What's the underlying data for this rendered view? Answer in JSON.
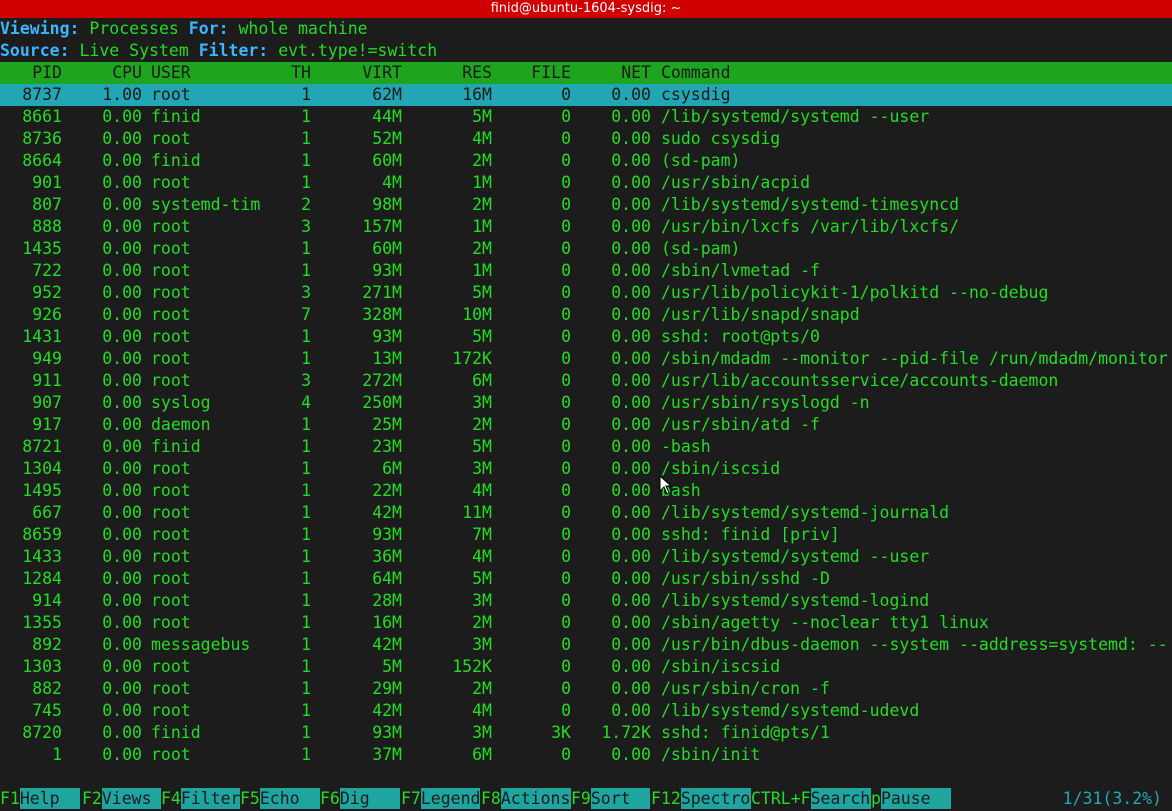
{
  "window": {
    "title": "finid@ubuntu-1604-sysdig: ~"
  },
  "header": {
    "viewing_key": "Viewing:",
    "viewing_value": "Processes",
    "for_key": "For:",
    "for_value": "whole machine",
    "source_key": "Source:",
    "source_value": "Live System",
    "filter_key": "Filter:",
    "filter_value": "evt.type!=switch"
  },
  "columns": {
    "pid": "PID",
    "cpu": "CPU",
    "user": "USER",
    "th": "TH",
    "virt": "VIRT",
    "res": "RES",
    "file": "FILE",
    "net": "NET",
    "command": "Command"
  },
  "processes": [
    {
      "pid": "8737",
      "cpu": "1.00",
      "user": "root",
      "th": "1",
      "virt": "62M",
      "res": "16M",
      "file": "0",
      "net": "0.00",
      "command": "csysdig"
    },
    {
      "pid": "8661",
      "cpu": "0.00",
      "user": "finid",
      "th": "1",
      "virt": "44M",
      "res": "5M",
      "file": "0",
      "net": "0.00",
      "command": "/lib/systemd/systemd --user"
    },
    {
      "pid": "8736",
      "cpu": "0.00",
      "user": "root",
      "th": "1",
      "virt": "52M",
      "res": "4M",
      "file": "0",
      "net": "0.00",
      "command": "sudo csysdig"
    },
    {
      "pid": "8664",
      "cpu": "0.00",
      "user": "finid",
      "th": "1",
      "virt": "60M",
      "res": "2M",
      "file": "0",
      "net": "0.00",
      "command": "(sd-pam)"
    },
    {
      "pid": "901",
      "cpu": "0.00",
      "user": "root",
      "th": "1",
      "virt": "4M",
      "res": "1M",
      "file": "0",
      "net": "0.00",
      "command": "/usr/sbin/acpid"
    },
    {
      "pid": "807",
      "cpu": "0.00",
      "user": "systemd-tim",
      "th": "2",
      "virt": "98M",
      "res": "2M",
      "file": "0",
      "net": "0.00",
      "command": "/lib/systemd/systemd-timesyncd"
    },
    {
      "pid": "888",
      "cpu": "0.00",
      "user": "root",
      "th": "3",
      "virt": "157M",
      "res": "1M",
      "file": "0",
      "net": "0.00",
      "command": "/usr/bin/lxcfs /var/lib/lxcfs/"
    },
    {
      "pid": "1435",
      "cpu": "0.00",
      "user": "root",
      "th": "1",
      "virt": "60M",
      "res": "2M",
      "file": "0",
      "net": "0.00",
      "command": "(sd-pam)"
    },
    {
      "pid": "722",
      "cpu": "0.00",
      "user": "root",
      "th": "1",
      "virt": "93M",
      "res": "1M",
      "file": "0",
      "net": "0.00",
      "command": "/sbin/lvmetad -f"
    },
    {
      "pid": "952",
      "cpu": "0.00",
      "user": "root",
      "th": "3",
      "virt": "271M",
      "res": "5M",
      "file": "0",
      "net": "0.00",
      "command": "/usr/lib/policykit-1/polkitd --no-debug"
    },
    {
      "pid": "926",
      "cpu": "0.00",
      "user": "root",
      "th": "7",
      "virt": "328M",
      "res": "10M",
      "file": "0",
      "net": "0.00",
      "command": "/usr/lib/snapd/snapd"
    },
    {
      "pid": "1431",
      "cpu": "0.00",
      "user": "root",
      "th": "1",
      "virt": "93M",
      "res": "5M",
      "file": "0",
      "net": "0.00",
      "command": "sshd: root@pts/0"
    },
    {
      "pid": "949",
      "cpu": "0.00",
      "user": "root",
      "th": "1",
      "virt": "13M",
      "res": "172K",
      "file": "0",
      "net": "0.00",
      "command": "/sbin/mdadm --monitor --pid-file /run/mdadm/monitor"
    },
    {
      "pid": "911",
      "cpu": "0.00",
      "user": "root",
      "th": "3",
      "virt": "272M",
      "res": "6M",
      "file": "0",
      "net": "0.00",
      "command": "/usr/lib/accountsservice/accounts-daemon"
    },
    {
      "pid": "907",
      "cpu": "0.00",
      "user": "syslog",
      "th": "4",
      "virt": "250M",
      "res": "3M",
      "file": "0",
      "net": "0.00",
      "command": "/usr/sbin/rsyslogd -n"
    },
    {
      "pid": "917",
      "cpu": "0.00",
      "user": "daemon",
      "th": "1",
      "virt": "25M",
      "res": "2M",
      "file": "0",
      "net": "0.00",
      "command": "/usr/sbin/atd -f"
    },
    {
      "pid": "8721",
      "cpu": "0.00",
      "user": "finid",
      "th": "1",
      "virt": "23M",
      "res": "5M",
      "file": "0",
      "net": "0.00",
      "command": "-bash"
    },
    {
      "pid": "1304",
      "cpu": "0.00",
      "user": "root",
      "th": "1",
      "virt": "6M",
      "res": "3M",
      "file": "0",
      "net": "0.00",
      "command": "/sbin/iscsid"
    },
    {
      "pid": "1495",
      "cpu": "0.00",
      "user": "root",
      "th": "1",
      "virt": "22M",
      "res": "4M",
      "file": "0",
      "net": "0.00",
      "command": "bash"
    },
    {
      "pid": "667",
      "cpu": "0.00",
      "user": "root",
      "th": "1",
      "virt": "42M",
      "res": "11M",
      "file": "0",
      "net": "0.00",
      "command": "/lib/systemd/systemd-journald"
    },
    {
      "pid": "8659",
      "cpu": "0.00",
      "user": "root",
      "th": "1",
      "virt": "93M",
      "res": "7M",
      "file": "0",
      "net": "0.00",
      "command": "sshd: finid [priv]"
    },
    {
      "pid": "1433",
      "cpu": "0.00",
      "user": "root",
      "th": "1",
      "virt": "36M",
      "res": "4M",
      "file": "0",
      "net": "0.00",
      "command": "/lib/systemd/systemd --user"
    },
    {
      "pid": "1284",
      "cpu": "0.00",
      "user": "root",
      "th": "1",
      "virt": "64M",
      "res": "5M",
      "file": "0",
      "net": "0.00",
      "command": "/usr/sbin/sshd -D"
    },
    {
      "pid": "914",
      "cpu": "0.00",
      "user": "root",
      "th": "1",
      "virt": "28M",
      "res": "3M",
      "file": "0",
      "net": "0.00",
      "command": "/lib/systemd/systemd-logind"
    },
    {
      "pid": "1355",
      "cpu": "0.00",
      "user": "root",
      "th": "1",
      "virt": "16M",
      "res": "2M",
      "file": "0",
      "net": "0.00",
      "command": "/sbin/agetty --noclear tty1 linux"
    },
    {
      "pid": "892",
      "cpu": "0.00",
      "user": "messagebus",
      "th": "1",
      "virt": "42M",
      "res": "3M",
      "file": "0",
      "net": "0.00",
      "command": "/usr/bin/dbus-daemon --system --address=systemd: --"
    },
    {
      "pid": "1303",
      "cpu": "0.00",
      "user": "root",
      "th": "1",
      "virt": "5M",
      "res": "152K",
      "file": "0",
      "net": "0.00",
      "command": "/sbin/iscsid"
    },
    {
      "pid": "882",
      "cpu": "0.00",
      "user": "root",
      "th": "1",
      "virt": "29M",
      "res": "2M",
      "file": "0",
      "net": "0.00",
      "command": "/usr/sbin/cron -f"
    },
    {
      "pid": "745",
      "cpu": "0.00",
      "user": "root",
      "th": "1",
      "virt": "42M",
      "res": "4M",
      "file": "0",
      "net": "0.00",
      "command": "/lib/systemd/systemd-udevd"
    },
    {
      "pid": "8720",
      "cpu": "0.00",
      "user": "finid",
      "th": "1",
      "virt": "93M",
      "res": "3M",
      "file": "3K",
      "net": "1.72K",
      "command": "sshd: finid@pts/1"
    },
    {
      "pid": "1",
      "cpu": "0.00",
      "user": "root",
      "th": "1",
      "virt": "37M",
      "res": "6M",
      "file": "0",
      "net": "0.00",
      "command": "/sbin/init"
    }
  ],
  "selected_index": 0,
  "fkeys": [
    {
      "key": "F1",
      "label": "Help"
    },
    {
      "key": "F2",
      "label": "Views"
    },
    {
      "key": "F4",
      "label": "Filter"
    },
    {
      "key": "F5",
      "label": "Echo"
    },
    {
      "key": "F6",
      "label": "Dig"
    },
    {
      "key": "F7",
      "label": "Legend"
    },
    {
      "key": "F8",
      "label": "Actions"
    },
    {
      "key": "F9",
      "label": "Sort"
    },
    {
      "key": "F12",
      "label": "Spectro"
    },
    {
      "key": "CTRL+F",
      "label": "Search"
    },
    {
      "key": "p",
      "label": "Pause"
    }
  ],
  "position": "1/31(3.2%)",
  "colors": {
    "titlebar": "#d00000",
    "text_green": "#22dd22",
    "keyword_blue": "#3ab5ff",
    "header_bar": "#1ea51e",
    "selected_row": "#22a6b3",
    "fkey_label_bg": "#1fa5a0"
  }
}
